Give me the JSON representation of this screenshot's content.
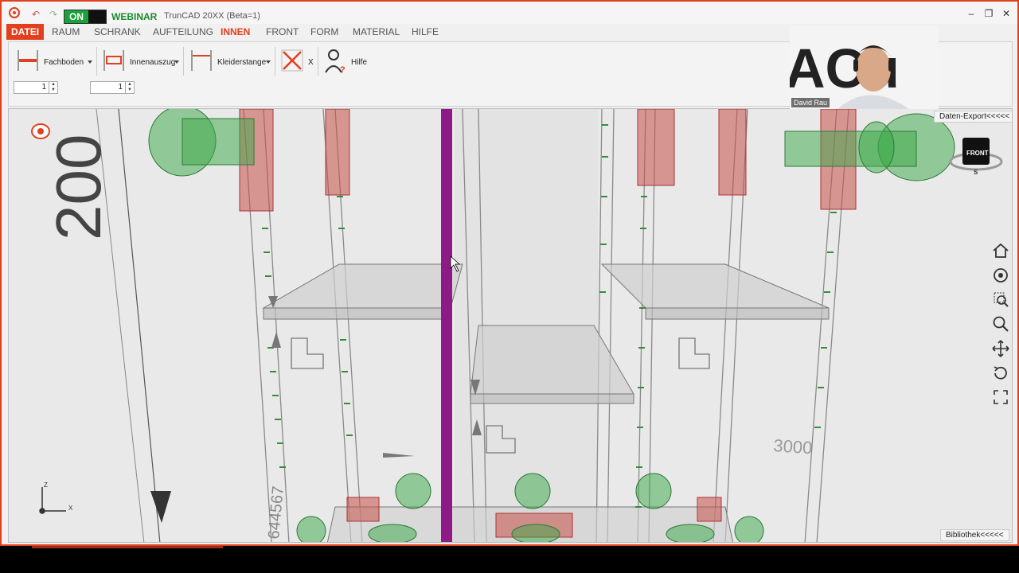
{
  "titlebar": {
    "on_label": "ON",
    "webinar_label": "WEBINAR",
    "app_title": "TrunCAD 20XX (Beta=1)",
    "min_glyph": "–",
    "max_glyph": "❐",
    "close_glyph": "✕"
  },
  "menu": {
    "datei": "DATEI",
    "raum": "RAUM",
    "schrank": "SCHRANK",
    "aufteilung": "AUFTEILUNG",
    "innen": "INNEN",
    "front": "FRONT",
    "form": "FORM",
    "material": "MATERIAL",
    "hilfe": "HILFE"
  },
  "toolbar": {
    "fachboden": "Fachboden",
    "innenauszug": "Innenauszug",
    "kleiderstange": "Kleiderstange",
    "delete_label": "X",
    "hilfe": "Hilfe",
    "spin1_value": "1",
    "spin2_value": "1"
  },
  "viewport": {
    "dim_200": "200",
    "dim_3000": "3000",
    "dim_vertical": "644567",
    "front_cube_label": "FRONT",
    "compass_s": "S",
    "axis_z": "Z",
    "axis_x": "X"
  },
  "panels": {
    "daten_export": "Daten-Export<<<<<",
    "bibliothek": "Bibliothek<<<<<"
  },
  "webcam": {
    "name": "David Rau",
    "bg_text": "ACu"
  },
  "colors": {
    "accent": "#e2401c",
    "on_green": "#1aa23a",
    "selected_panel": "#8e1a88",
    "fitting_green": "#3aa845",
    "rail_red": "#c8504a"
  }
}
